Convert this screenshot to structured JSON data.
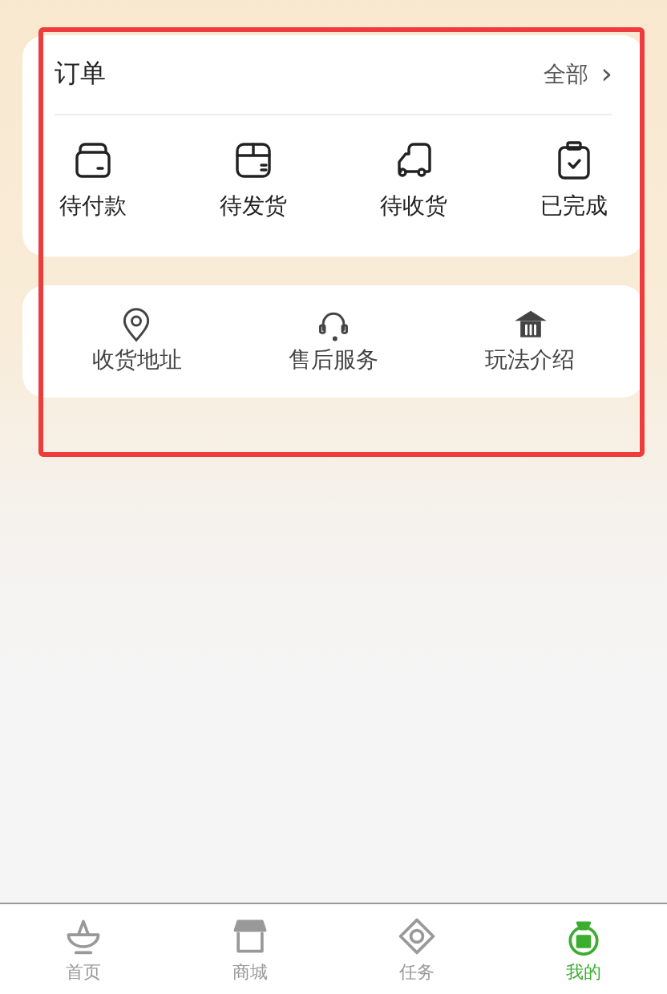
{
  "orders": {
    "title": "订单",
    "all_link": "全部",
    "chevron": "›",
    "statuses": [
      {
        "label": "待付款"
      },
      {
        "label": "待发货"
      },
      {
        "label": "待收货"
      },
      {
        "label": "已完成"
      }
    ]
  },
  "services": [
    {
      "label": "收货地址"
    },
    {
      "label": "售后服务"
    },
    {
      "label": "玩法介绍"
    }
  ],
  "tab_bar": [
    {
      "label": "首页",
      "selected": false
    },
    {
      "label": "商城",
      "selected": false
    },
    {
      "label": "任务",
      "selected": false
    },
    {
      "label": "我的",
      "selected": true
    }
  ]
}
